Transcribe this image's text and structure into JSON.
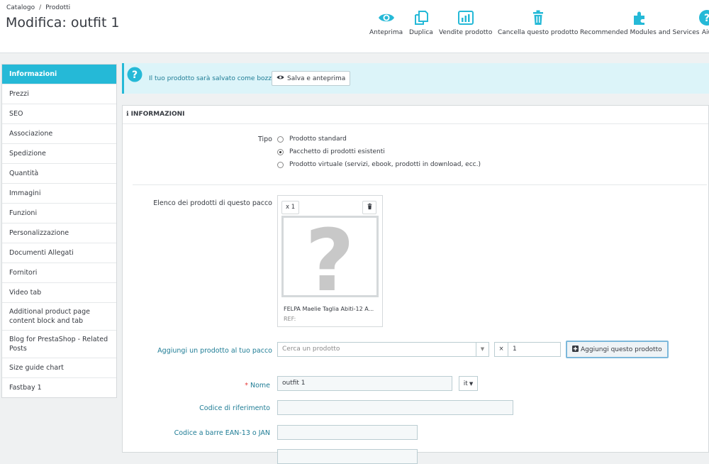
{
  "breadcrumb": {
    "parent": "Catalogo",
    "separator": "/",
    "current": "Prodotti"
  },
  "page_title": "Modifica: outfit 1",
  "toolbar": [
    {
      "label": "Anteprima",
      "icon": "eye-icon"
    },
    {
      "label": "Duplica",
      "icon": "copy-icon"
    },
    {
      "label": "Vendite prodotto",
      "icon": "bar-chart-icon"
    },
    {
      "label": "Cancella questo prodotto",
      "icon": "trash-icon"
    },
    {
      "label": "Recommended Modules and Services",
      "icon": "puzzle-icon"
    },
    {
      "label": "Aiu",
      "icon": "help-icon"
    }
  ],
  "sidebar": {
    "items": [
      {
        "label": "Informazioni",
        "active": true
      },
      {
        "label": "Prezzi"
      },
      {
        "label": "SEO"
      },
      {
        "label": "Associazione"
      },
      {
        "label": "Spedizione"
      },
      {
        "label": "Quantità"
      },
      {
        "label": "Immagini"
      },
      {
        "label": "Funzioni"
      },
      {
        "label": "Personalizzazione"
      },
      {
        "label": "Documenti Allegati"
      },
      {
        "label": "Fornitori"
      },
      {
        "label": "Video tab"
      },
      {
        "label": "Additional product page content block and tab"
      },
      {
        "label": "Blog for PrestaShop - Related Posts"
      },
      {
        "label": "Size guide chart"
      },
      {
        "label": "Fastbay 1"
      }
    ]
  },
  "alert": {
    "text": "Il tuo prodotto sarà salvato come bozza.",
    "button": "Salva e anteprima"
  },
  "panel": {
    "heading": "INFORMAZIONI",
    "type_label": "Tipo",
    "type_options": [
      {
        "label": "Prodotto standard",
        "checked": false
      },
      {
        "label": "Pacchetto di prodotti esistenti",
        "checked": true
      },
      {
        "label": "Prodotto virtuale (servizi, ebook, prodotti in download, ecc.)",
        "checked": false
      }
    ],
    "pack_label": "Elenco dei prodotti di questo pacco",
    "pack_item": {
      "quantity": "x 1",
      "name": "FELPA Maelie Taglia Abiti-12 A...",
      "ref": "REF:"
    },
    "add_label": "Aggiungi un prodotto al tuo pacco",
    "search_placeholder": "Cerca un prodotto",
    "qty_prefix": "×",
    "qty_value": "1",
    "add_button": "Aggiungi questo prodotto",
    "name_label": "Nome",
    "name_value": "outfit 1",
    "lang": "it",
    "reference_label": "Codice di riferimento",
    "reference_value": "",
    "ean_label": "Codice a barre EAN-13 o JAN",
    "ean_value": ""
  },
  "colors": {
    "accent": "#25b9d7",
    "label_link": "#1e7c95",
    "required": "#e63b3b"
  }
}
